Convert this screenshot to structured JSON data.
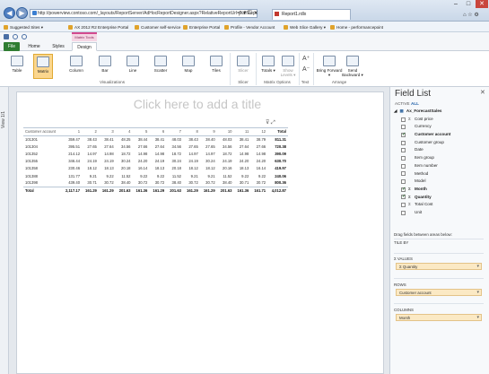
{
  "browser": {
    "url": "http://powerview.contoso.com/_layouts/ReportServer/AdHocReportDesigner.aspx?RelativeReportUrl=%2fReport1.rdlx",
    "tab_title": "Report1.rdlx",
    "nav_back": "◀",
    "nav_fwd": "▶",
    "addr_controls": "ρ ▾ ☐ ✕",
    "win_min": "–",
    "win_max": "□",
    "win_close": "✕",
    "toolbar_icons": "⌂ ☆ ⚙"
  },
  "favorites": [
    {
      "label": "Suggested Sites ▾"
    },
    {
      "label": "AX 2012 R2 Enterprise Portal"
    },
    {
      "label": "Customer self-service"
    },
    {
      "label": "Enterprise Portal"
    },
    {
      "label": "Profile - Vendor Account"
    },
    {
      "label": "Web Slice Gallery ▾"
    },
    {
      "label": "Home - performancepoint"
    }
  ],
  "ribbon": {
    "context_label": "Matrix Tools",
    "tabs": {
      "file": "File",
      "home": "Home",
      "styles": "Styles",
      "design": "Design"
    },
    "buttons": {
      "table": "Table",
      "matrix": "Matrix",
      "column": "Column",
      "bar": "Bar",
      "line": "Line",
      "scatter": "Scatter",
      "map": "Map",
      "tiles": "Tiles",
      "slicer": "Slicer",
      "totals": "Totals ▾",
      "show_levels": "Show Levels ▾",
      "bring_forward": "Bring Forward ▾",
      "send_backward": "Send Backward ▾"
    },
    "groups": {
      "visualizations": "Visualizations",
      "filter": "Slicer",
      "matrix_options": "Matrix Options",
      "text": "Text",
      "arrange": "Arrange"
    }
  },
  "view": {
    "label": "View 1/1",
    "title_placeholder": "Click here to add a title"
  },
  "matrix": {
    "row_header": "Customer account",
    "columns": [
      "1",
      "2",
      "3",
      "4",
      "5",
      "6",
      "7",
      "8",
      "9",
      "10",
      "11",
      "12",
      "Total"
    ],
    "rows": [
      {
        "account": "101301",
        "values": [
          "359.47",
          "38.43",
          "38.41",
          "48.25",
          "38.44",
          "38.41",
          "48.03",
          "38.43",
          "38.40",
          "48.03",
          "38.41",
          "38.79",
          "811.31"
        ]
      },
      {
        "account": "101304",
        "values": [
          "395.51",
          "27.65",
          "27.64",
          "34.56",
          "27.66",
          "27.64",
          "34.56",
          "27.65",
          "27.65",
          "34.56",
          "27.64",
          "27.66",
          "720.38"
        ]
      },
      {
        "account": "101352",
        "values": [
          "214.12",
          "14.97",
          "14.98",
          "18.72",
          "14.98",
          "14.98",
          "18.72",
          "14.97",
          "14.97",
          "18.72",
          "14.98",
          "14.98",
          "390.09"
        ]
      },
      {
        "account": "101355",
        "values": [
          "346.44",
          "24.19",
          "24.19",
          "30.24",
          "24.20",
          "24.19",
          "30.24",
          "24.19",
          "30.24",
          "24.19",
          "24.20",
          "24.20",
          "630.70"
        ]
      },
      {
        "account": "101358",
        "values": [
          "230.46",
          "18.12",
          "18.13",
          "20.18",
          "16.14",
          "18.13",
          "20.18",
          "18.12",
          "18.12",
          "20.16",
          "18.13",
          "16.14",
          "419.97"
        ]
      },
      {
        "account": "101388",
        "values": [
          "131.77",
          "9.21",
          "9.22",
          "11.52",
          "9.22",
          "9.22",
          "11.52",
          "9.21",
          "9.21",
          "11.52",
          "9.22",
          "9.22",
          "240.06"
        ]
      },
      {
        "account": "101398",
        "values": [
          "439.40",
          "30.71",
          "30.72",
          "38.40",
          "30.72",
          "30.72",
          "38.40",
          "30.72",
          "30.72",
          "38.40",
          "30.71",
          "30.72",
          "800.36"
        ]
      }
    ],
    "total_label": "Total",
    "totals": [
      "2,117.17",
      "161.29",
      "161.29",
      "201.63",
      "161.36",
      "161.29",
      "201.63",
      "161.29",
      "161.29",
      "201.63",
      "161.36",
      "161.71",
      "4,012.87"
    ]
  },
  "field_list": {
    "title": "Field List",
    "close": "✕",
    "tab_active": "ACTIVE",
    "tab_all": "ALL",
    "table_name": "Ax_ForecastSales",
    "fields": [
      {
        "name": "Cost price",
        "checked": false,
        "bold": false,
        "sigma": true
      },
      {
        "name": "Currency",
        "checked": false,
        "bold": false,
        "sigma": false
      },
      {
        "name": "Customer account",
        "checked": true,
        "bold": true,
        "sigma": false
      },
      {
        "name": "Customer group",
        "checked": false,
        "bold": false,
        "sigma": false
      },
      {
        "name": "Date",
        "checked": false,
        "bold": false,
        "sigma": false
      },
      {
        "name": "Item group",
        "checked": false,
        "bold": false,
        "sigma": false
      },
      {
        "name": "Item number",
        "checked": false,
        "bold": false,
        "sigma": false
      },
      {
        "name": "Method",
        "checked": false,
        "bold": false,
        "sigma": false
      },
      {
        "name": "Model",
        "checked": false,
        "bold": false,
        "sigma": false
      },
      {
        "name": "Month",
        "checked": true,
        "bold": true,
        "sigma": true
      },
      {
        "name": "Quantity",
        "checked": true,
        "bold": true,
        "sigma": true
      },
      {
        "name": "Total Cost",
        "checked": false,
        "bold": false,
        "sigma": true
      },
      {
        "name": "Unit",
        "checked": false,
        "bold": false,
        "sigma": false
      }
    ],
    "drag_hint": "Drag fields between areas below:",
    "tile_by": "TILE BY",
    "values_label": "Σ VALUES",
    "values_item": "Σ Quantity",
    "rows_label": "ROWS",
    "rows_item": "Customer account",
    "columns_label": "COLUMNS",
    "columns_item": "Month"
  }
}
